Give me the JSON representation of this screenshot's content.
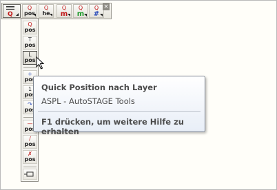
{
  "toolbar": {
    "buttons": [
      {
        "top": "",
        "bot": "",
        "icon": "lines-q-icon"
      },
      {
        "top": "Q",
        "bot": "pos",
        "icon": "q-pos-icon"
      },
      {
        "top": "Q",
        "bot": "he",
        "icon": "q-he-icon"
      },
      {
        "top": "Q",
        "bot": "m",
        "icon": "q-m-red-icon"
      },
      {
        "top": "Q",
        "bot": "m",
        "icon": "q-m-green-icon"
      },
      {
        "top": "Q",
        "bot": "#",
        "icon": "q-hash-icon"
      }
    ],
    "close_label": "×"
  },
  "flyout": {
    "buttons": [
      {
        "top": "Q",
        "bot": "pos",
        "icon": "q-pos-icon"
      },
      {
        "top": "T",
        "bot": "pos",
        "icon": "t-pos-icon"
      },
      {
        "top": "L",
        "bot": "pos",
        "icon": "l-pos-icon"
      },
      {
        "top": "+",
        "bot": "pos",
        "icon": "plus-pos-icon"
      },
      {
        "top": "1",
        "bot": "pos",
        "icon": "one-pos-icon"
      },
      {
        "top": "↷",
        "bot": "pos",
        "icon": "rotate-pos-icon"
      },
      {
        "top": "—",
        "bot": "pos",
        "icon": "strike-pos-icon"
      },
      {
        "top": "/",
        "bot": "pos",
        "icon": "slash-pos-icon"
      },
      {
        "top": "✗",
        "bot": "pos",
        "icon": "cross-pos-icon"
      },
      {
        "top": "",
        "bot": "",
        "icon": "insert-icon"
      }
    ]
  },
  "tooltip": {
    "title": "Quick Position nach Layer",
    "subtitle": "ASPL - AutoSTAGE Tools",
    "help": "F1 drücken, um weitere Hilfe zu erhalten"
  }
}
